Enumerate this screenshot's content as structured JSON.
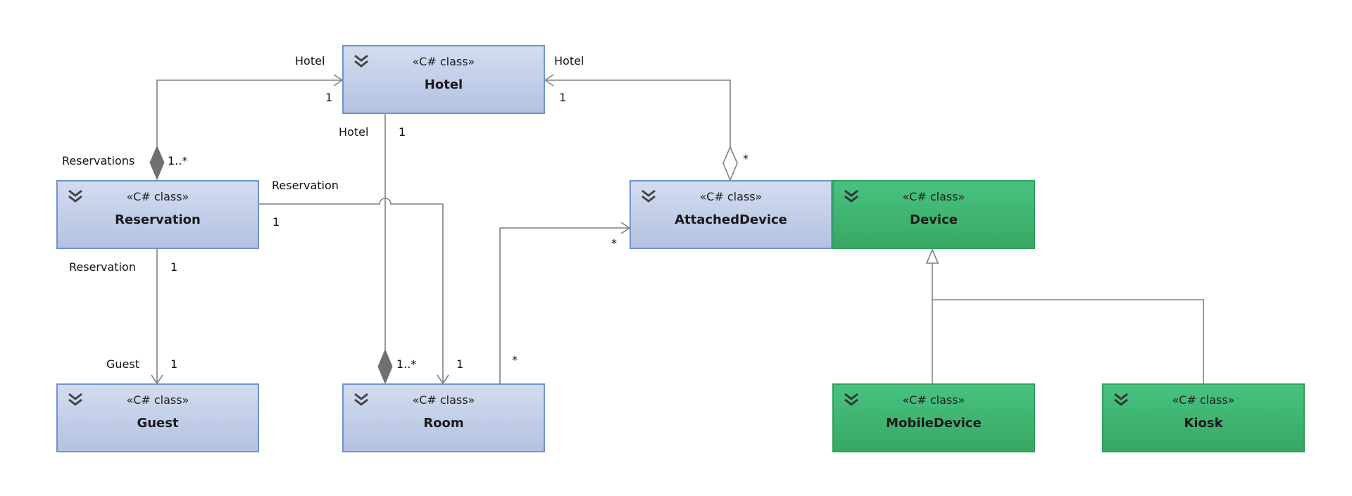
{
  "classes": [
    {
      "id": "hotel",
      "stereotype": "«C# class»",
      "name": "Hotel",
      "color": "#b4c2e1"
    },
    {
      "id": "reservation",
      "stereotype": "«C# class»",
      "name": "Reservation",
      "color": "#b4c2e1"
    },
    {
      "id": "guest",
      "stereotype": "«C# class»",
      "name": "Guest",
      "color": "#b4c2e1"
    },
    {
      "id": "room",
      "stereotype": "«C# class»",
      "name": "Room",
      "color": "#b4c2e1"
    },
    {
      "id": "attacheddevice",
      "stereotype": "«C# class»",
      "name": "AttachedDevice",
      "color": "#b4c2e1"
    },
    {
      "id": "device",
      "stereotype": "«C# class»",
      "name": "Device",
      "color": "#3fb46f"
    },
    {
      "id": "mobiledevice",
      "stereotype": "«C# class»",
      "name": "MobileDevice",
      "color": "#3fb46f"
    },
    {
      "id": "kiosk",
      "stereotype": "«C# class»",
      "name": "Kiosk",
      "color": "#3fb46f"
    }
  ],
  "labels": {
    "res_hotel_role": "Hotel",
    "res_hotel_mult": "1",
    "res_role": "Reservations",
    "res_mult": "1..*",
    "ad_hotel_role": "Hotel",
    "ad_hotel_mult": "1",
    "ad_mult": "*",
    "room_hotel_role": "Hotel",
    "room_hotel_mult": "1",
    "room_mult": "1..*",
    "resroom_role": "Reservation",
    "resroom_mult": "1",
    "room_end_mult": "1",
    "resguest_role": "Reservation",
    "resguest_mult": "1",
    "guest_role": "Guest",
    "guest_mult": "1",
    "room_ad_mult": "*",
    "ad_end_mult": "*"
  },
  "relationships": [
    {
      "from": "Reservation",
      "to": "Hotel",
      "kind": "composition"
    },
    {
      "from": "Room",
      "to": "Hotel",
      "kind": "composition"
    },
    {
      "from": "AttachedDevice",
      "to": "Hotel",
      "kind": "aggregation"
    },
    {
      "from": "Reservation",
      "to": "Room",
      "kind": "association"
    },
    {
      "from": "Reservation",
      "to": "Guest",
      "kind": "association"
    },
    {
      "from": "Room",
      "to": "AttachedDevice",
      "kind": "association"
    },
    {
      "from": "MobileDevice",
      "to": "Device",
      "kind": "generalization"
    },
    {
      "from": "Kiosk",
      "to": "Device",
      "kind": "generalization"
    }
  ]
}
